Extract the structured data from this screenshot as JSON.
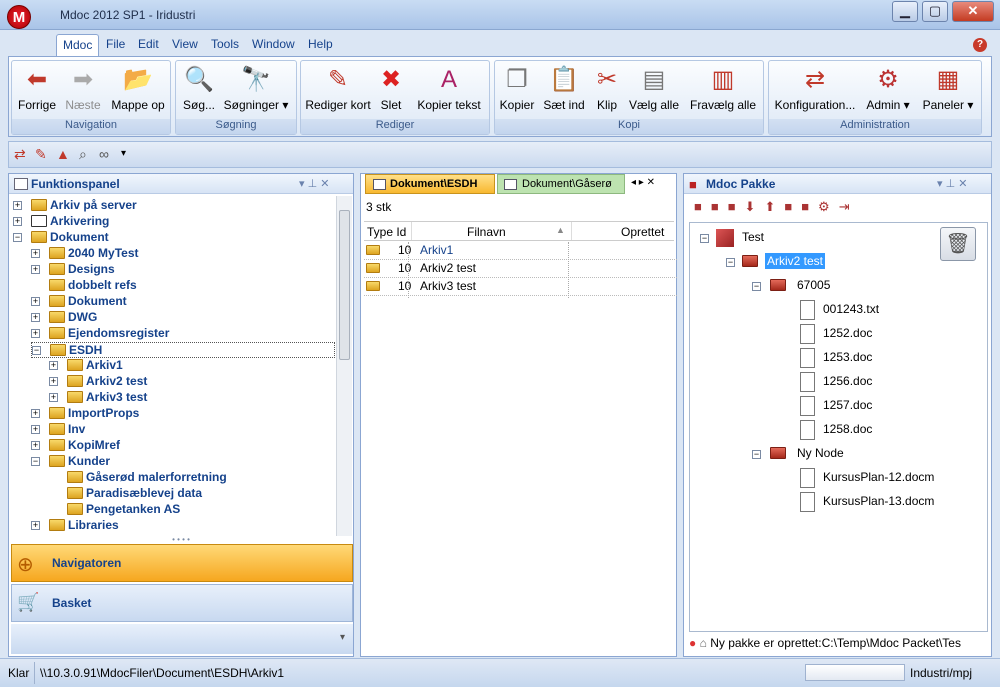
{
  "window": {
    "title": "Mdoc 2012 SP1 - Iridustri",
    "logo_letter": "M",
    "minimize": "▁",
    "maximize": "▢",
    "close": "✕"
  },
  "menu": [
    "Mdoc",
    "File",
    "Edit",
    "View",
    "Tools",
    "Window",
    "Help"
  ],
  "help_icon": "?",
  "ribbon": {
    "groups": [
      "Navigation",
      "Søgning",
      "Rediger",
      "Kopi",
      "Administration"
    ],
    "buttons": {
      "forrige": "Forrige",
      "naeste": "Næste",
      "mappe_op": "Mappe op",
      "soeg": "Søg...",
      "soegninger": "Søgninger",
      "rediger_kort": "Rediger kort",
      "slet": "Slet",
      "kopier_tekst": "Kopier tekst",
      "kopier": "Kopier",
      "saet_ind": "Sæt ind",
      "klip": "Klip",
      "vaelg_alle": "Vælg alle",
      "fravaelg_alle": "Fravælg alle",
      "konfiguration": "Konfiguration...",
      "admin": "Admin",
      "paneler": "Paneler"
    }
  },
  "left_panel": {
    "title": "Funktionspanel",
    "tree": [
      {
        "label": "Arkiv på server",
        "level": 0,
        "expander": "+"
      },
      {
        "label": "Arkivering",
        "level": 0,
        "expander": "+"
      },
      {
        "label": "Dokument",
        "level": 0,
        "expander": "−"
      },
      {
        "label": "2040 MyTest",
        "level": 1,
        "expander": "+"
      },
      {
        "label": "Designs",
        "level": 1,
        "expander": "+"
      },
      {
        "label": "dobbelt refs",
        "level": 1,
        "expander": ""
      },
      {
        "label": "Dokument",
        "level": 1,
        "expander": "+"
      },
      {
        "label": "DWG",
        "level": 1,
        "expander": "+"
      },
      {
        "label": "Ejendomsregister",
        "level": 1,
        "expander": "+"
      },
      {
        "label": "ESDH",
        "level": 1,
        "expander": "−",
        "selected": true
      },
      {
        "label": "Arkiv1",
        "level": 2,
        "expander": "+"
      },
      {
        "label": "Arkiv2 test",
        "level": 2,
        "expander": "+"
      },
      {
        "label": "Arkiv3 test",
        "level": 2,
        "expander": "+"
      },
      {
        "label": "ImportProps",
        "level": 1,
        "expander": "+"
      },
      {
        "label": "Inv",
        "level": 1,
        "expander": "+"
      },
      {
        "label": "KopiMref",
        "level": 1,
        "expander": "+"
      },
      {
        "label": "Kunder",
        "level": 1,
        "expander": "−"
      },
      {
        "label": "Gåserød malerforretning",
        "level": 2,
        "expander": ""
      },
      {
        "label": "Paradisæblevej data",
        "level": 2,
        "expander": ""
      },
      {
        "label": "Pengetanken AS",
        "level": 2,
        "expander": ""
      },
      {
        "label": "Libraries",
        "level": 1,
        "expander": "+"
      }
    ],
    "nav_buttons": [
      "Navigatoren",
      "Basket"
    ]
  },
  "middle_panel": {
    "tabs": [
      "Dokument\\ESDH",
      "Dokument\\Gåserø"
    ],
    "count": "3 stk",
    "columns": [
      "Type Id",
      "Filnavn",
      "Oprettet"
    ],
    "rows": [
      {
        "type_id": "10",
        "filnavn": "Arkiv1"
      },
      {
        "type_id": "10",
        "filnavn": "Arkiv2 test"
      },
      {
        "type_id": "10",
        "filnavn": "Arkiv3 test"
      }
    ]
  },
  "right_panel": {
    "title": "Mdoc Pakke",
    "tree": {
      "root": "Test",
      "child": "Arkiv2 test",
      "folder1": "67005",
      "files1": [
        "001243.txt",
        "1252.doc",
        "1253.doc",
        "1256.doc",
        "1257.doc",
        "1258.doc"
      ],
      "folder2": "Ny Node",
      "files2": [
        "KursusPlan-12.docm",
        "KursusPlan-13.docm"
      ]
    },
    "status": "Ny pakke er oprettet:C:\\Temp\\Mdoc Packet\\Tes"
  },
  "statusbar": {
    "state": "Klar",
    "path": "\\\\10.3.0.91\\MdocFiler\\Document\\ESDH\\Arkiv1",
    "user": "Industri/mpj"
  }
}
